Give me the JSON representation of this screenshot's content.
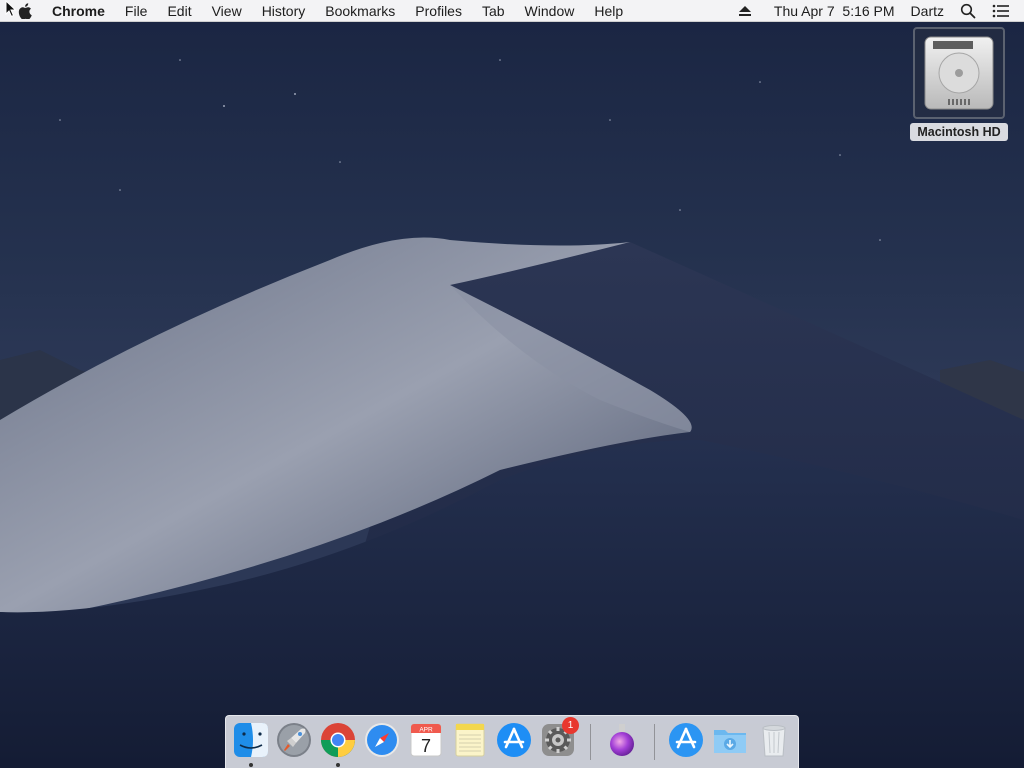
{
  "menubar": {
    "app_name": "Chrome",
    "items": [
      "File",
      "Edit",
      "View",
      "History",
      "Bookmarks",
      "Profiles",
      "Tab",
      "Window",
      "Help"
    ],
    "status": {
      "eject_icon": "eject-icon",
      "datetime": "Thu Apr 7  5:16 PM",
      "user": "Dartz",
      "search_icon": "spotlight-search-icon",
      "list_icon": "notification-center-icon"
    }
  },
  "desktop": {
    "drive_label": "Macintosh HD"
  },
  "dock": {
    "apps": [
      {
        "name": "Finder",
        "icon": "finder-icon",
        "running": true
      },
      {
        "name": "Launchpad",
        "icon": "launchpad-icon",
        "running": false
      },
      {
        "name": "Google Chrome",
        "icon": "chrome-icon",
        "running": true
      },
      {
        "name": "Safari",
        "icon": "safari-icon",
        "running": false
      },
      {
        "name": "Calendar",
        "icon": "calendar-icon",
        "month": "APR",
        "day": "7",
        "running": false
      },
      {
        "name": "Notes",
        "icon": "notes-icon",
        "running": false
      },
      {
        "name": "App Store",
        "icon": "app-store-icon",
        "running": false
      },
      {
        "name": "System Preferences",
        "icon": "system-preferences-icon",
        "badge": "1",
        "running": false
      },
      {
        "name": "Installer",
        "icon": "installer-icon",
        "running": false
      },
      {
        "name": "Applications",
        "icon": "applications-folder-icon",
        "running": false
      },
      {
        "name": "Downloads",
        "icon": "downloads-folder-icon",
        "running": false
      },
      {
        "name": "Trash",
        "icon": "trash-icon",
        "running": false
      }
    ]
  },
  "colors": {
    "menubar_bg": "#f3f3f5",
    "dock_bg": "#e1e4ea",
    "badge": "#e8382f"
  }
}
